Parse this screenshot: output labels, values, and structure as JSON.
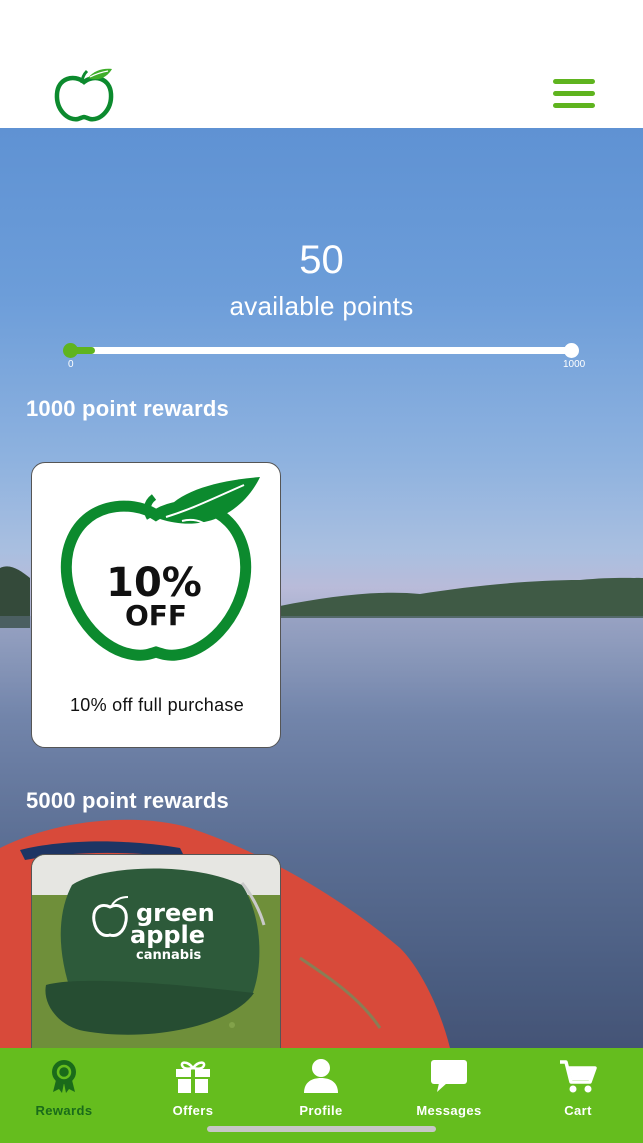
{
  "header": {
    "logo_icon": "green-apple-logo-icon",
    "menu_icon": "hamburger-menu-icon"
  },
  "points": {
    "value": "50",
    "label": "available points",
    "progress_min": "0",
    "progress_max": "1000",
    "progress_fraction": 0.05
  },
  "sections": [
    {
      "title": "1000 point rewards",
      "cards": [
        {
          "image_text_line1": "10%",
          "image_text_line2": "OFF",
          "label": "10% off full purchase"
        }
      ]
    },
    {
      "title": "5000 point rewards",
      "cards": [
        {
          "image_text_line1": "green",
          "image_text_line2": "apple",
          "image_text_line3": "cannabis",
          "image_subject": "green cap"
        }
      ]
    }
  ],
  "nav": {
    "items": [
      {
        "label": "Rewards",
        "icon": "award-ribbon-icon",
        "active": true
      },
      {
        "label": "Offers",
        "icon": "gift-icon",
        "active": false
      },
      {
        "label": "Profile",
        "icon": "person-icon",
        "active": false
      },
      {
        "label": "Messages",
        "icon": "chat-bubble-icon",
        "active": false
      },
      {
        "label": "Cart",
        "icon": "cart-icon",
        "active": false
      }
    ]
  },
  "colors": {
    "brand_green": "#5fb41f",
    "nav_background": "#65bd1e",
    "active_nav": "#1a6b1a",
    "logo_green": "#0c8a2e"
  }
}
